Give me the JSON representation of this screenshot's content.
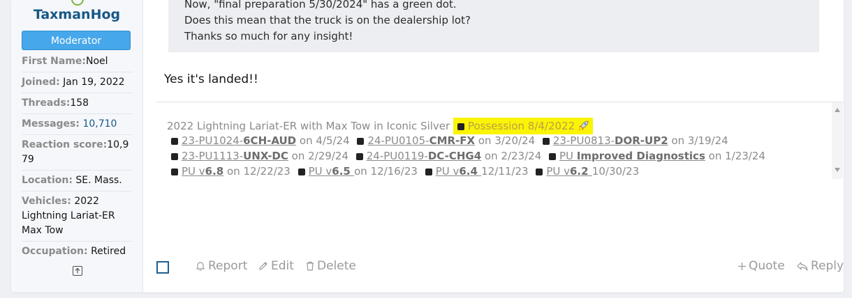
{
  "user": {
    "username": "TaxmanHog",
    "role": "Moderator",
    "fields": [
      {
        "key": "First Name:",
        "value": "Noel"
      },
      {
        "key": "Joined:",
        "value": "Jan 19, 2022"
      },
      {
        "key": "Threads:",
        "value": "158"
      },
      {
        "key": "Messages:",
        "value": "10,710"
      },
      {
        "key": "Reaction score:",
        "value": "10,979"
      },
      {
        "key": "Location:",
        "value": "SE. Mass."
      },
      {
        "key": "Vehicles:",
        "value": "2022 Lightning Lariat-ER Max Tow"
      },
      {
        "key": "Occupation:",
        "value": "Retired"
      }
    ]
  },
  "quote": {
    "lines": [
      "Now, \"final preparation 5/30/2024\" has a green dot.",
      "Does this mean that the truck is on the dealership lot?",
      "Thanks so much for any insight!"
    ]
  },
  "post": {
    "body": "Yes it's landed!!"
  },
  "signature": {
    "vehicle": "2022 Lightning Lariat-ER with Max Tow in Iconic Silver",
    "possession": "Possession 8/4/2022",
    "updates": [
      {
        "pre": "23-PU1024-",
        "code": "6CH-AUD",
        "date": " on 4/5/24"
      },
      {
        "pre": "24-PU0105-",
        "code": "CMR-FX",
        "date": " on 3/20/24"
      },
      {
        "pre": "23-PU0813-",
        "code": "DOR-UP2",
        "date": " on 3/19/24"
      },
      {
        "pre": "23-PU1113-",
        "code": "UNX-DC",
        "date": " on 2/29/24"
      },
      {
        "pre": "24-PU0119-",
        "code": "DC-CHG4",
        "date": " on 2/23/24"
      },
      {
        "pre": "PU ",
        "code": "Improved Diagnostics",
        "date": " on 1/23/24"
      },
      {
        "pre": "PU v",
        "code": "6.8",
        "date": " on 12/22/23"
      },
      {
        "pre": "PU v",
        "code": "6.5 ",
        "date": "on 12/16/23"
      },
      {
        "pre": "PU v",
        "code": "6.4 ",
        "date": "12/11/23"
      },
      {
        "pre": "PU v",
        "code": "6.2 ",
        "date": "10/30/23"
      }
    ]
  },
  "actions": {
    "report": "Report",
    "edit": "Edit",
    "delete": "Delete",
    "quote": "Quote",
    "reply": "Reply"
  },
  "icons": {
    "report": "bell-icon",
    "edit": "pencil-icon",
    "delete": "trash-icon",
    "quote": "plus-icon",
    "reply": "reply-arrow-icon",
    "scroll_top": "arrow-up-box-icon"
  },
  "colors": {
    "username": "#185886",
    "badge": "#47a7eb",
    "highlight": "#fbf405",
    "select_box": "#1f5d8e"
  }
}
